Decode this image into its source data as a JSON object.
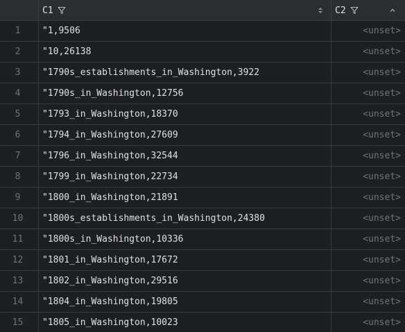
{
  "header": {
    "c1_label": "C1",
    "c2_label": "C2"
  },
  "icons": {
    "filter": "filter-icon",
    "sort": "sort-icon",
    "collapse": "chevron-up-icon"
  },
  "colors": {
    "background": "#1e1f22",
    "header_background": "#2b2d30",
    "grid_line": "#393b40",
    "text": "#dfe1e5",
    "muted": "#6f737a"
  },
  "rows": [
    {
      "num": "1",
      "c1": "\"1,9506",
      "c2": "<unset>"
    },
    {
      "num": "2",
      "c1": "\"10,26138",
      "c2": "<unset>"
    },
    {
      "num": "3",
      "c1": "\"1790s_establishments_in_Washington,3922",
      "c2": "<unset>"
    },
    {
      "num": "4",
      "c1": "\"1790s_in_Washington,12756",
      "c2": "<unset>"
    },
    {
      "num": "5",
      "c1": "\"1793_in_Washington,18370",
      "c2": "<unset>"
    },
    {
      "num": "6",
      "c1": "\"1794_in_Washington,27609",
      "c2": "<unset>"
    },
    {
      "num": "7",
      "c1": "\"1796_in_Washington,32544",
      "c2": "<unset>"
    },
    {
      "num": "8",
      "c1": "\"1799_in_Washington,22734",
      "c2": "<unset>"
    },
    {
      "num": "9",
      "c1": "\"1800_in_Washington,21891",
      "c2": "<unset>"
    },
    {
      "num": "10",
      "c1": "\"1800s_establishments_in_Washington,24380",
      "c2": "<unset>"
    },
    {
      "num": "11",
      "c1": "\"1800s_in_Washington,10336",
      "c2": "<unset>"
    },
    {
      "num": "12",
      "c1": "\"1801_in_Washington,17672",
      "c2": "<unset>"
    },
    {
      "num": "13",
      "c1": "\"1802_in_Washington,29516",
      "c2": "<unset>"
    },
    {
      "num": "14",
      "c1": "\"1804_in_Washington,19805",
      "c2": "<unset>"
    },
    {
      "num": "15",
      "c1": "\"1805_in_Washington,10023",
      "c2": "<unset>"
    }
  ]
}
